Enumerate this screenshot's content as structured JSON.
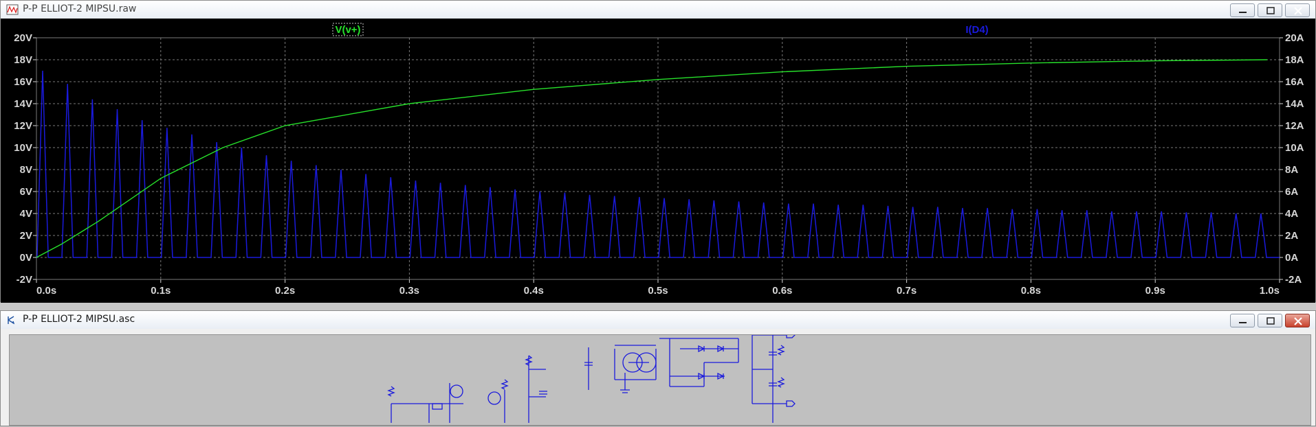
{
  "windows": {
    "raw": {
      "title": "P-P ELLIOT-2 MIPSU.raw"
    },
    "asc": {
      "title": "P-P ELLIOT-2 MIPSU.asc"
    }
  },
  "colors": {
    "trace_v": "#27e22b",
    "trace_i": "#1a1adc",
    "plot_bg": "#000000",
    "axis_text": "#d8d8d8",
    "grid": "#7a7a7a"
  },
  "chart_data": {
    "type": "line",
    "x_label_ticks": [
      "0.0s",
      "0.1s",
      "0.2s",
      "0.3s",
      "0.4s",
      "0.5s",
      "0.6s",
      "0.7s",
      "0.8s",
      "0.9s",
      "1.0s"
    ],
    "xlim": [
      0,
      1.0
    ],
    "y_left_ticks": [
      "20V",
      "18V",
      "16V",
      "14V",
      "12V",
      "10V",
      "8V",
      "6V",
      "4V",
      "2V",
      "0V",
      "-2V"
    ],
    "y_right_ticks": [
      "20A",
      "18A",
      "16A",
      "14A",
      "12A",
      "10A",
      "8A",
      "6A",
      "4A",
      "2A",
      "0A",
      "-2A"
    ],
    "ylim": [
      -2,
      20
    ],
    "grid": true,
    "series": [
      {
        "name": "V(v+)",
        "x": [
          0.0,
          0.02,
          0.05,
          0.1,
          0.15,
          0.2,
          0.3,
          0.4,
          0.5,
          0.6,
          0.7,
          0.8,
          0.9,
          0.99
        ],
        "values": [
          0.0,
          1.2,
          3.3,
          7.2,
          10.0,
          12.0,
          14.0,
          15.3,
          16.2,
          16.9,
          17.4,
          17.7,
          17.9,
          18.0
        ]
      },
      {
        "name": "I(D4)",
        "peaks_x": [
          0.005,
          0.025,
          0.045,
          0.065,
          0.085,
          0.105,
          0.125,
          0.145,
          0.165,
          0.185,
          0.205,
          0.225,
          0.245,
          0.265,
          0.285,
          0.305,
          0.325,
          0.345,
          0.365,
          0.385,
          0.405,
          0.425,
          0.445,
          0.465,
          0.485,
          0.505,
          0.525,
          0.545,
          0.565,
          0.585,
          0.605,
          0.625,
          0.645,
          0.665,
          0.685,
          0.705,
          0.725,
          0.745,
          0.765,
          0.785,
          0.805,
          0.825,
          0.845,
          0.865,
          0.885,
          0.905,
          0.925,
          0.945,
          0.965,
          0.985
        ],
        "peaks": [
          17.0,
          15.8,
          14.4,
          13.5,
          12.5,
          11.8,
          11.2,
          10.5,
          10.0,
          9.3,
          8.8,
          8.4,
          8.0,
          7.6,
          7.3,
          7.0,
          6.8,
          6.6,
          6.4,
          6.2,
          6.0,
          5.9,
          5.7,
          5.6,
          5.5,
          5.4,
          5.3,
          5.2,
          5.1,
          5.0,
          4.9,
          4.9,
          4.8,
          4.8,
          4.7,
          4.6,
          4.6,
          4.5,
          4.5,
          4.4,
          4.4,
          4.3,
          4.3,
          4.2,
          4.2,
          4.2,
          4.1,
          4.1,
          4.0,
          4.0
        ]
      }
    ]
  }
}
